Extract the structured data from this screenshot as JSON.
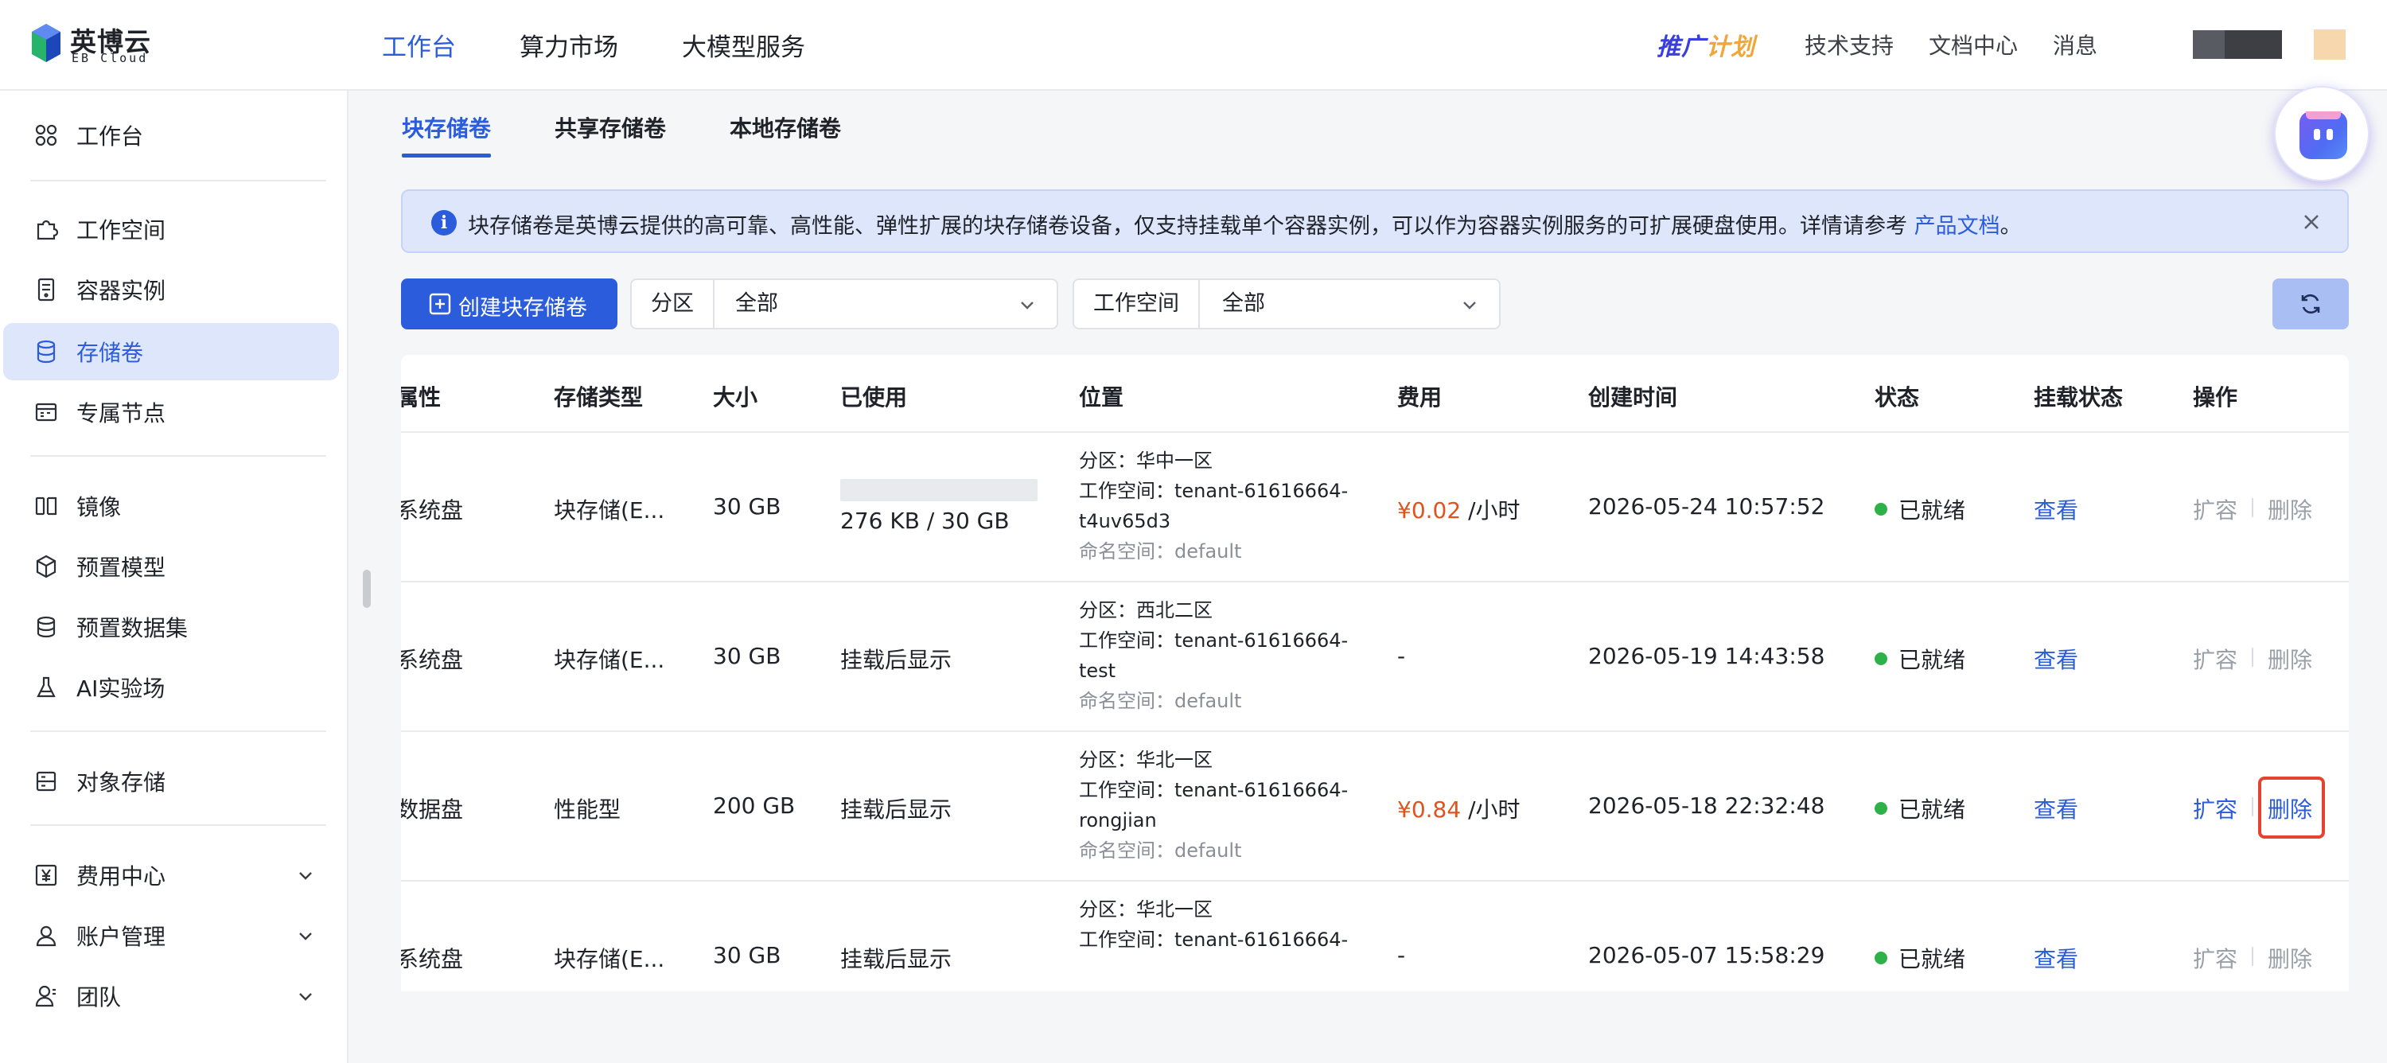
{
  "brand": {
    "name": "英博云",
    "subtitle": "EB Cloud",
    "colors": {
      "accent": "#2a5cdb",
      "fee": "#e0531f",
      "ready": "#2fb14a",
      "highlight": "#e3432f"
    }
  },
  "topnav": {
    "items": [
      "工作台",
      "算力市场",
      "大模型服务"
    ],
    "active": "工作台"
  },
  "topright": {
    "promo": [
      "推广",
      "计划"
    ],
    "links": [
      "技术支持",
      "文档中心",
      "消息"
    ]
  },
  "sidebar": {
    "items": [
      {
        "label": "工作台",
        "icon": "dashboard-icon"
      },
      {
        "label": "工作空间",
        "icon": "puzzle-icon"
      },
      {
        "label": "容器实例",
        "icon": "container-icon"
      },
      {
        "label": "存储卷",
        "icon": "database-icon",
        "active": true
      },
      {
        "label": "专属节点",
        "icon": "node-icon"
      },
      {
        "label": "镜像",
        "icon": "image-icon"
      },
      {
        "label": "预置模型",
        "icon": "cube-icon"
      },
      {
        "label": "预置数据集",
        "icon": "dataset-icon"
      },
      {
        "label": "AI实验场",
        "icon": "flask-icon"
      },
      {
        "label": "对象存储",
        "icon": "object-storage-icon"
      },
      {
        "label": "费用中心",
        "icon": "yen-icon",
        "expandable": true
      },
      {
        "label": "账户管理",
        "icon": "user-icon",
        "expandable": true
      },
      {
        "label": "团队",
        "icon": "team-icon",
        "expandable": true
      }
    ]
  },
  "tabs": [
    "块存储卷",
    "共享存储卷",
    "本地存储卷"
  ],
  "banner": {
    "text": "块存储卷是英博云提供的高可靠、高性能、弹性扩展的块存储卷设备，仅支持挂载单个容器实例，可以作为容器实例服务的可扩展硬盘使用。详情请参考",
    "link": "产品文档",
    "end": "。"
  },
  "toolbar": {
    "create_label": "创建块存储卷",
    "zone_label": "分区",
    "zone_value": "全部",
    "workspace_label": "工作空间",
    "workspace_value": "全部"
  },
  "table": {
    "columns": [
      "属性",
      "存储类型",
      "大小",
      "已使用",
      "位置",
      "费用",
      "创建时间",
      "状态",
      "挂载状态",
      "操作"
    ],
    "rows": [
      {
        "attr": "系统盘",
        "type": "块存储(E...",
        "size": "30 GB",
        "used": "276 KB / 30 GB",
        "used_fraction": 0.0,
        "zone": "分区：华中一区",
        "workspace": "工作空间：tenant-61616664-",
        "workspace2": "t4uv65d3",
        "namespace": "命名空间：default",
        "fee_amount": "¥0.02",
        "fee_unit": " /小时",
        "created": "2026-05-24 10:57:52",
        "status": "已就绪",
        "mount": "查看",
        "expand": "扩容",
        "delete": "删除",
        "enabled": false
      },
      {
        "attr": "系统盘",
        "type": "块存储(E...",
        "size": "30 GB",
        "used": "挂载后显示",
        "zone": "分区：西北二区",
        "workspace": "工作空间：tenant-61616664-",
        "workspace2": "test",
        "namespace": "命名空间：default",
        "fee_amount": "-",
        "fee_unit": "",
        "created": "2026-05-19 14:43:58",
        "status": "已就绪",
        "mount": "查看",
        "expand": "扩容",
        "delete": "删除",
        "enabled": false
      },
      {
        "attr": "数据盘",
        "type": "性能型",
        "size": "200 GB",
        "used": "挂载后显示",
        "zone": "分区：华北一区",
        "workspace": "工作空间：tenant-61616664-",
        "workspace2": "rongjian",
        "namespace": "命名空间：default",
        "fee_amount": "¥0.84",
        "fee_unit": " /小时",
        "created": "2026-05-18 22:32:48",
        "status": "已就绪",
        "mount": "查看",
        "expand": "扩容",
        "delete": "删除",
        "enabled": true
      },
      {
        "attr": "系统盘",
        "type": "块存储(E...",
        "size": "30 GB",
        "used": "挂载后显示",
        "zone": "分区：华北一区",
        "workspace": "工作空间：tenant-61616664-",
        "fee_amount": "-",
        "fee_unit": "",
        "created": "2026-05-07 15:58:29",
        "status": "已就绪",
        "mount": "查看",
        "expand": "扩容",
        "delete": "删除",
        "enabled": false
      }
    ]
  }
}
